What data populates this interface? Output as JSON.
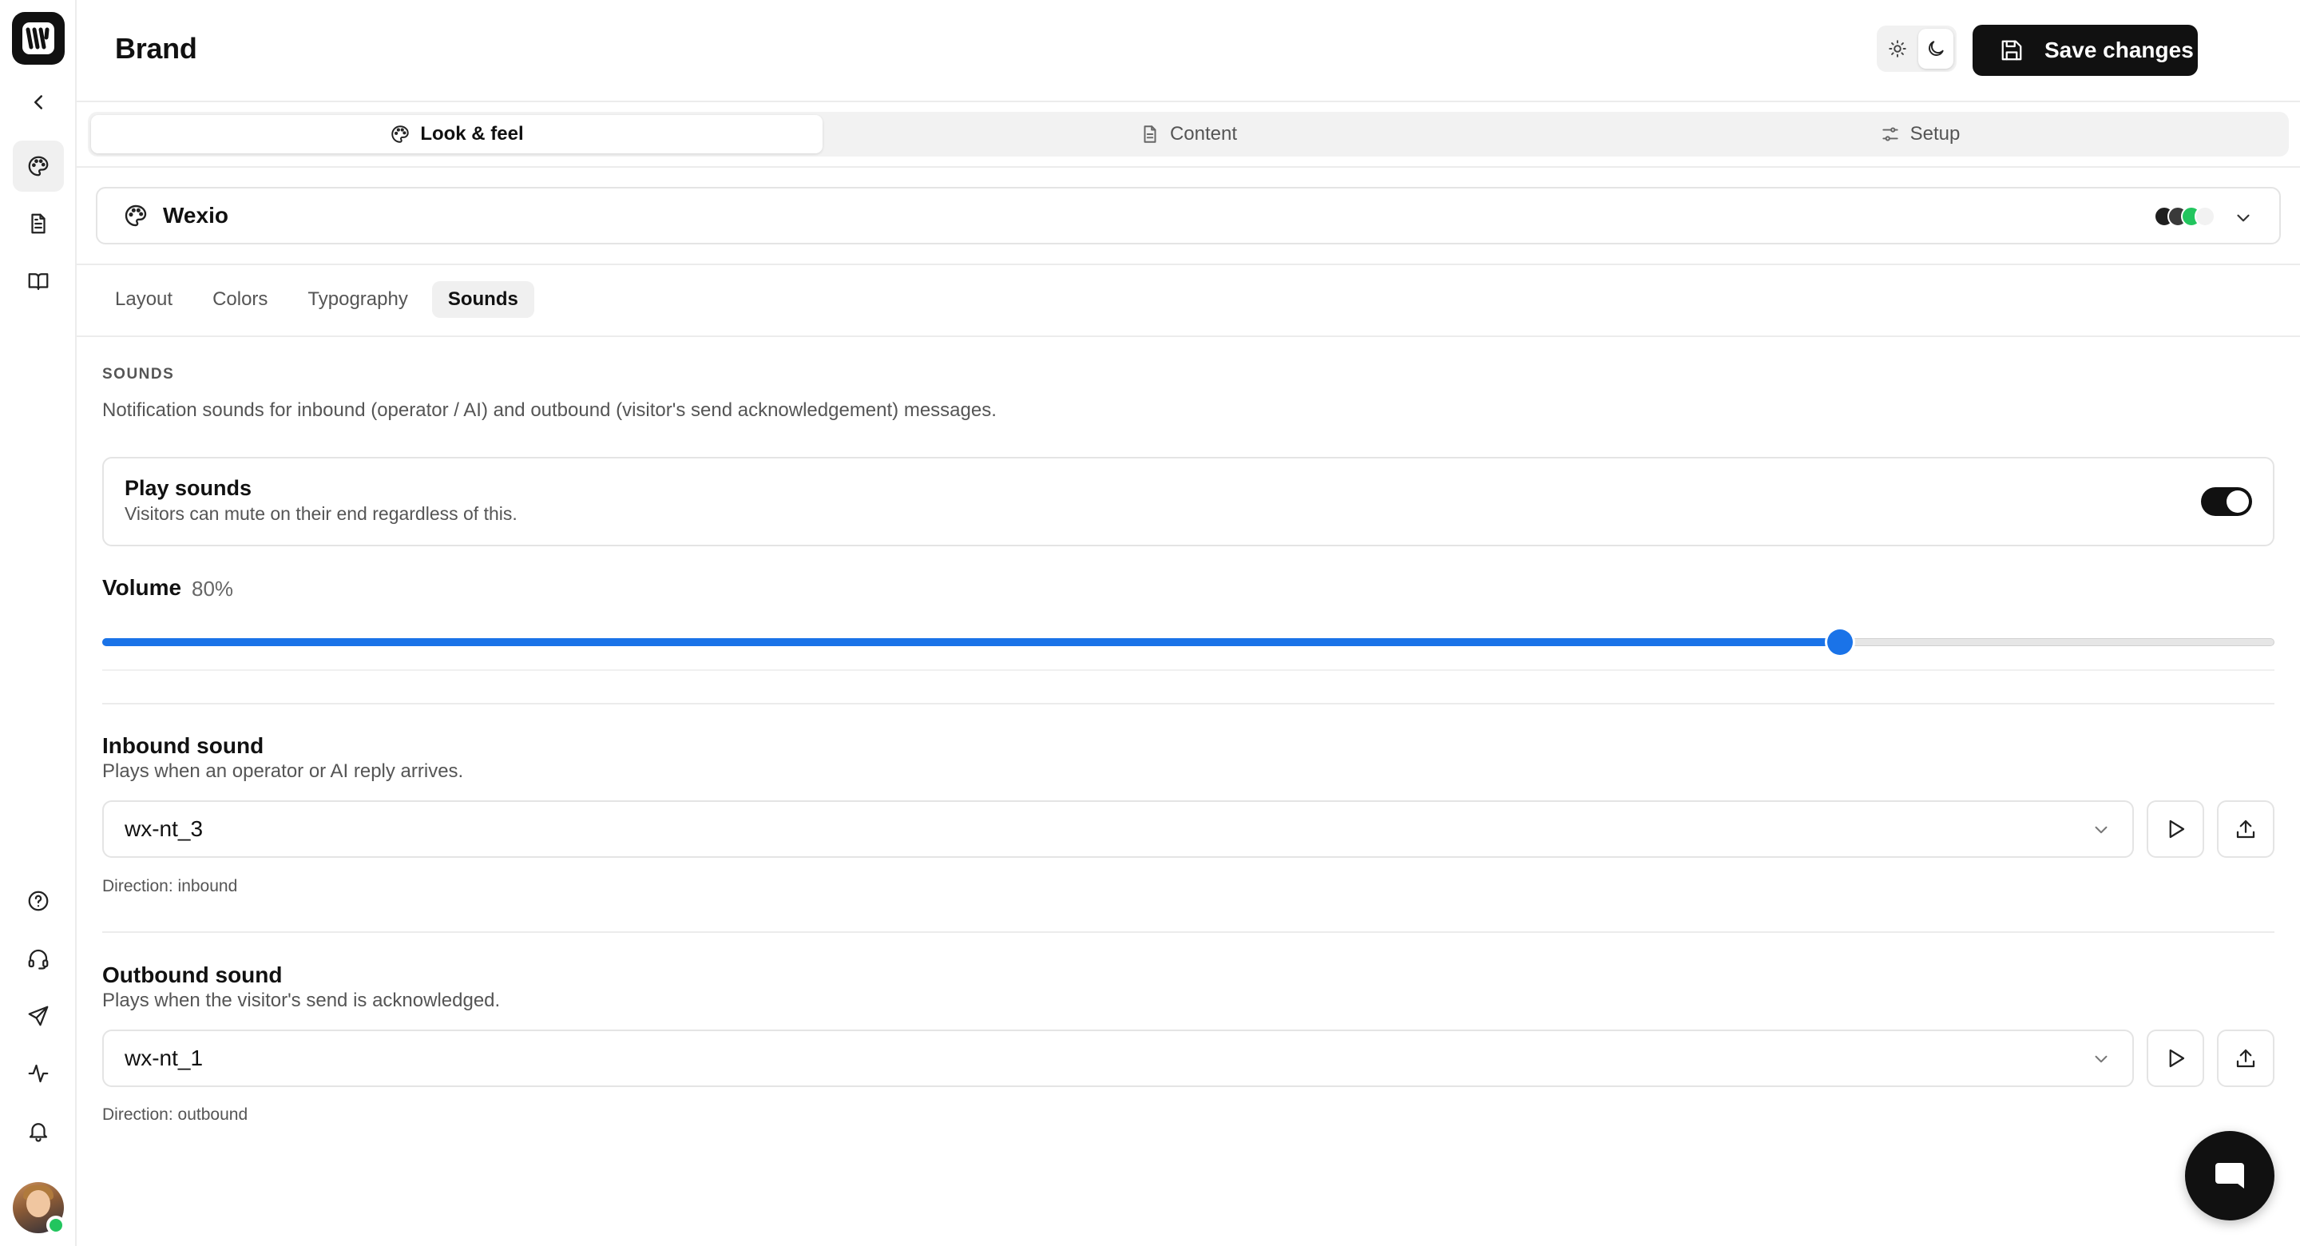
{
  "header": {
    "title": "Brand",
    "save_label": "Save changes",
    "more_label": "···"
  },
  "main_tabs": [
    {
      "label": "Look & feel",
      "icon": "palette-icon",
      "active": true
    },
    {
      "label": "Content",
      "icon": "document-icon",
      "active": false
    },
    {
      "label": "Setup",
      "icon": "settings-sliders-icon",
      "active": false
    }
  ],
  "brand_selector": {
    "name": "Wexio",
    "swatch_colors": [
      "#1f1f1f",
      "#3a3a3a",
      "#22c55e",
      "#f2f2f2"
    ]
  },
  "sub_tabs": [
    {
      "label": "Layout",
      "active": false
    },
    {
      "label": "Colors",
      "active": false
    },
    {
      "label": "Typography",
      "active": false
    },
    {
      "label": "Sounds",
      "active": true
    }
  ],
  "sounds": {
    "section_label": "SOUNDS",
    "description": "Notification sounds for inbound (operator / AI) and outbound (visitor's send acknowledgement) messages.",
    "play_sounds": {
      "title": "Play sounds",
      "subtitle": "Visitors can mute on their end regardless of this.",
      "enabled": true
    },
    "volume": {
      "label": "Volume",
      "value_text": "80%",
      "value": 0.8
    },
    "inbound": {
      "title": "Inbound sound",
      "subtitle": "Plays when an operator or AI reply arrives.",
      "selected": "wx-nt_3",
      "direction": "Direction: inbound"
    },
    "outbound": {
      "title": "Outbound sound",
      "subtitle": "Plays when the visitor's send is acknowledged.",
      "selected": "wx-nt_1",
      "direction": "Direction: outbound"
    }
  },
  "colors": {
    "accent": "#1a73e8",
    "primary": "#111111",
    "online": "#22c55e"
  }
}
